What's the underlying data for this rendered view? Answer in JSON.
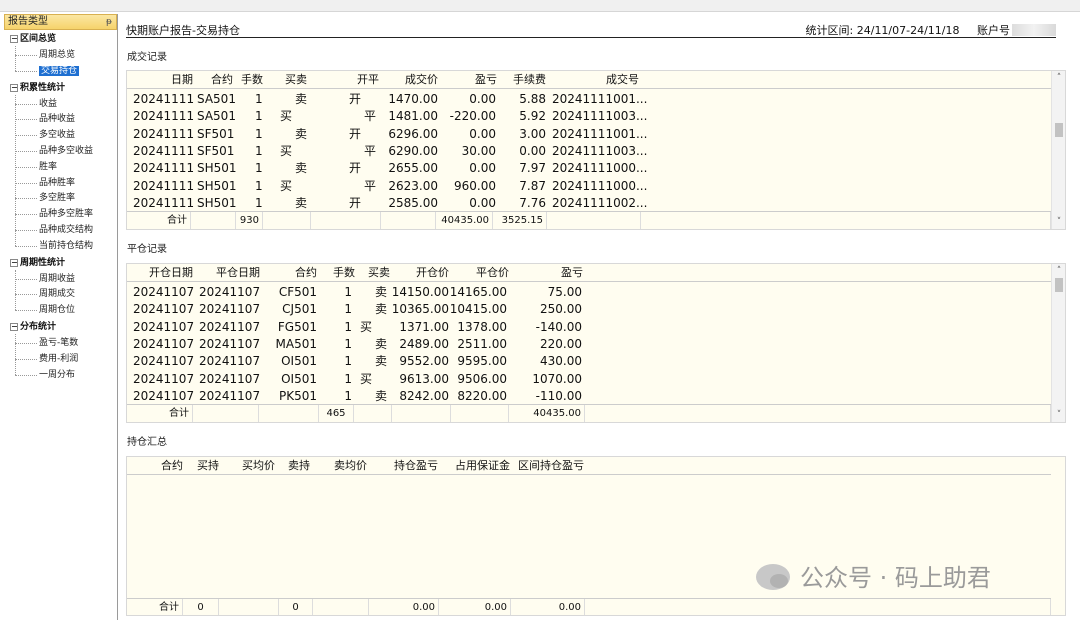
{
  "sidebar": {
    "header": "报告类型",
    "pin": "ᵽ",
    "groups": [
      {
        "label": "区间总览",
        "box": "⊟",
        "items": [
          "周期总览",
          "交易持仓"
        ]
      },
      {
        "label": "积累性统计",
        "box": "⊟",
        "items": [
          "收益",
          "品种收益",
          "多空收益",
          "品种多空收益",
          "胜率",
          "品种胜率",
          "多空胜率",
          "品种多空胜率",
          "品种成交结构",
          "当前持仓结构"
        ]
      },
      {
        "label": "周期性统计",
        "box": "⊟",
        "items": [
          "周期收益",
          "周期成交",
          "周期仓位"
        ]
      },
      {
        "label": "分布统计",
        "box": "⊟",
        "items": [
          "盈亏-笔数",
          "费用-利润",
          "一周分布"
        ]
      }
    ],
    "selected": "交易持仓"
  },
  "header": {
    "title": "快期账户报告-交易持仓",
    "range_label": "统计区间:",
    "range_value": "24/11/07-24/11/18",
    "account_label": "账户号"
  },
  "trades": {
    "label": "成交记录",
    "columns": [
      "日期",
      "合约",
      "手数",
      "买卖",
      "开平",
      "成交价",
      "盈亏",
      "手续费",
      "成交号"
    ],
    "rows": [
      [
        "20241111",
        "SA501",
        "1",
        "卖",
        "开",
        "1470.00",
        "0.00",
        "5.88",
        "20241111001..."
      ],
      [
        "20241111",
        "SA501",
        "1",
        "买",
        "平",
        "1481.00",
        "-220.00",
        "5.92",
        "20241111003..."
      ],
      [
        "20241111",
        "SF501",
        "1",
        "卖",
        "开",
        "6296.00",
        "0.00",
        "3.00",
        "20241111001..."
      ],
      [
        "20241111",
        "SF501",
        "1",
        "买",
        "平",
        "6290.00",
        "30.00",
        "0.00",
        "20241111003..."
      ],
      [
        "20241111",
        "SH501",
        "1",
        "卖",
        "开",
        "2655.00",
        "0.00",
        "7.97",
        "20241111000..."
      ],
      [
        "20241111",
        "SH501",
        "1",
        "买",
        "平",
        "2623.00",
        "960.00",
        "7.87",
        "20241111000..."
      ],
      [
        "20241111",
        "SH501",
        "1",
        "卖",
        "开",
        "2585.00",
        "0.00",
        "7.76",
        "20241111002..."
      ]
    ],
    "footer": {
      "label": "合计",
      "qty": "930",
      "pnl": "40435.00",
      "fee": "3525.15"
    }
  },
  "closes": {
    "label": "平仓记录",
    "columns": [
      "开仓日期",
      "平仓日期",
      "合约",
      "手数",
      "买卖",
      "开仓价",
      "平仓价",
      "盈亏"
    ],
    "rows": [
      [
        "20241107",
        "20241107",
        "CF501",
        "1",
        "卖",
        "14150.00",
        "14165.00",
        "75.00"
      ],
      [
        "20241107",
        "20241107",
        "CJ501",
        "1",
        "卖",
        "10365.00",
        "10415.00",
        "250.00"
      ],
      [
        "20241107",
        "20241107",
        "FG501",
        "1",
        "买",
        "1371.00",
        "1378.00",
        "-140.00"
      ],
      [
        "20241107",
        "20241107",
        "MA501",
        "1",
        "卖",
        "2489.00",
        "2511.00",
        "220.00"
      ],
      [
        "20241107",
        "20241107",
        "OI501",
        "1",
        "卖",
        "9552.00",
        "9595.00",
        "430.00"
      ],
      [
        "20241107",
        "20241107",
        "OI501",
        "1",
        "买",
        "9613.00",
        "9506.00",
        "1070.00"
      ],
      [
        "20241107",
        "20241107",
        "PK501",
        "1",
        "卖",
        "8242.00",
        "8220.00",
        "-110.00"
      ]
    ],
    "footer": {
      "label": "合计",
      "qty": "465",
      "pnl": "40435.00"
    }
  },
  "positions": {
    "label": "持仓汇总",
    "columns": [
      "合约",
      "买持",
      "买均价",
      "卖持",
      "卖均价",
      "持仓盈亏",
      "占用保证金",
      "区间持仓盈亏"
    ],
    "footer": {
      "label": "合计",
      "buy": "0",
      "sell": "0",
      "pos_pnl": "0.00",
      "margin": "0.00",
      "range_pnl": "0.00"
    }
  },
  "scroll": {
    "up": "˄",
    "down": "˅"
  },
  "watermark": "公众号 · 码上助君"
}
